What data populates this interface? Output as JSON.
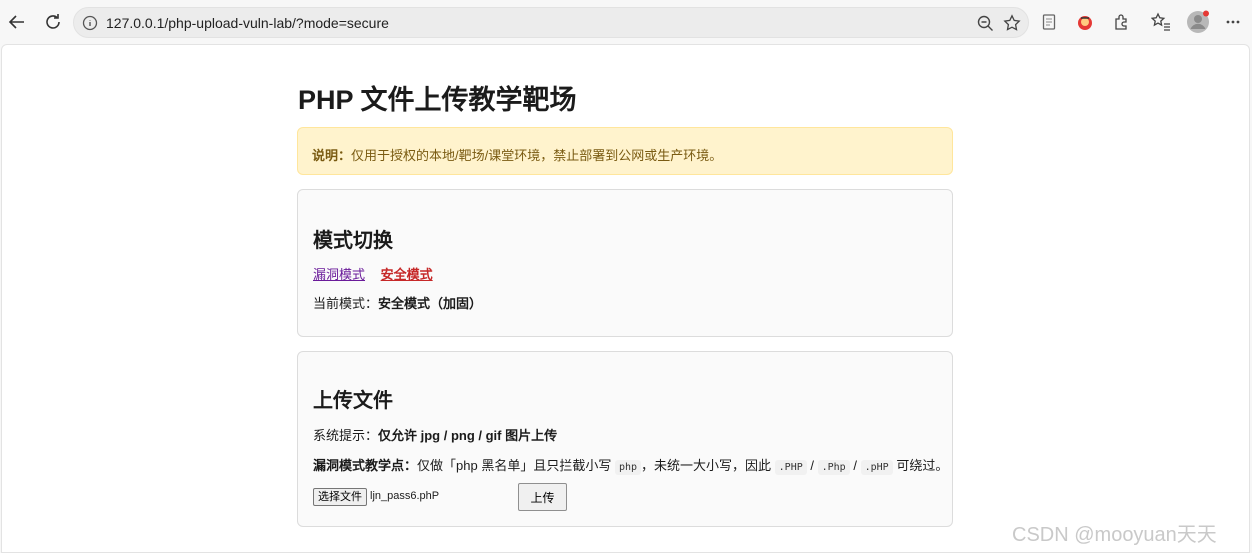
{
  "browser": {
    "url": "127.0.0.1/php-upload-vuln-lab/?mode=secure"
  },
  "page": {
    "title": "PHP 文件上传教学靶场",
    "notice": {
      "label": "说明：",
      "text": "仅用于授权的本地/靶场/课堂环境，禁止部署到公网或生产环境。"
    },
    "mode_card": {
      "heading": "模式切换",
      "vuln_link": "漏洞模式",
      "secure_link": "安全模式",
      "current_label": "当前模式：",
      "current_value": "安全模式（加固）"
    },
    "upload_card": {
      "heading": "上传文件",
      "hint_label": "系统提示：",
      "hint_value": "仅允许 jpg / png / gif 图片上传",
      "teach_label": "漏洞模式教学点：",
      "teach_text_1": "仅做「php 黑名单」且只拦截小写",
      "teach_code_1": "php",
      "teach_text_2": "，未统一大小写，因此",
      "teach_code_2": ".PHP",
      "teach_sep_1": "/",
      "teach_code_3": ".Php",
      "teach_sep_2": "/",
      "teach_code_4": ".pHP",
      "teach_text_3": "可绕过。",
      "choose_file_label": "选择文件",
      "file_name": "ljn_pass6.phP",
      "upload_label": "上传"
    }
  },
  "watermark": "CSDN @mooyuan天天"
}
